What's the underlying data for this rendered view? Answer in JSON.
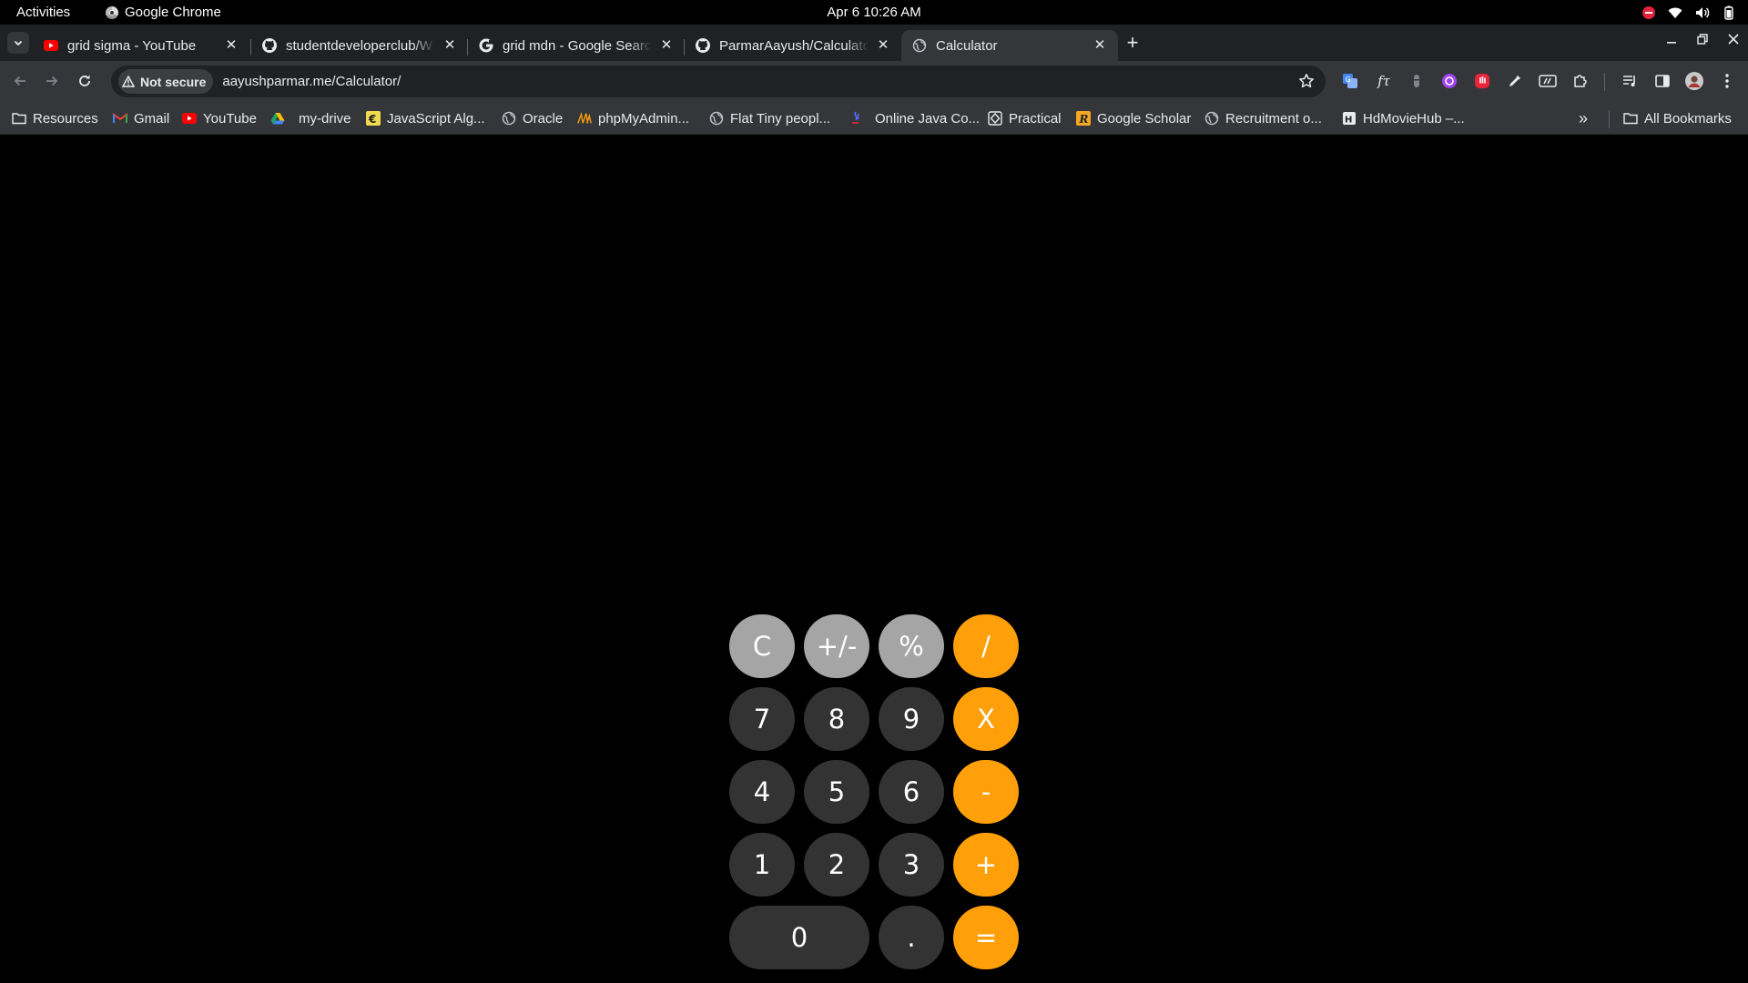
{
  "system_bar": {
    "activities": "Activities",
    "app_name": "Google Chrome",
    "clock": "Apr 6  10:26 AM"
  },
  "tabs": [
    {
      "title": "grid sigma - YouTube",
      "icon": "youtube-icon",
      "active": false
    },
    {
      "title": "studentdeveloperclub/W",
      "icon": "github-icon",
      "active": false
    },
    {
      "title": "grid mdn - Google Search",
      "icon": "google-icon",
      "active": false
    },
    {
      "title": "ParmarAayush/Calculato",
      "icon": "github-icon",
      "active": false
    },
    {
      "title": "Calculator",
      "icon": "globe-icon",
      "active": true
    }
  ],
  "toolbar": {
    "security_label": "Not secure",
    "url": "aayushparmar.me/Calculator/"
  },
  "bookmarks": [
    {
      "label": "Resources",
      "icon": "folder-icon"
    },
    {
      "label": "Gmail",
      "icon": "gmail-icon"
    },
    {
      "label": "YouTube",
      "icon": "youtube-icon"
    },
    {
      "label": "my-drive",
      "icon": "drive-icon"
    },
    {
      "label": "JavaScript Alg...",
      "icon": "js-icon"
    },
    {
      "label": "Oracle",
      "icon": "globe-icon"
    },
    {
      "label": "phpMyAdmin...",
      "icon": "phpmyadmin-icon"
    },
    {
      "label": "Flat Tiny peopl...",
      "icon": "globe-icon"
    },
    {
      "label": "Online Java Co...",
      "icon": "java-icon"
    },
    {
      "label": "Practical",
      "icon": "practical-icon"
    },
    {
      "label": "Google Scholar",
      "icon": "scholar-icon"
    },
    {
      "label": "Recruitment o...",
      "icon": "globe-icon"
    },
    {
      "label": "HdMovieHub –...",
      "icon": "movie-icon"
    }
  ],
  "all_bookmarks_label": "All Bookmarks",
  "calculator": {
    "display": "",
    "keys": {
      "clear": "C",
      "sign": "+/-",
      "percent": "%",
      "divide": "/",
      "seven": "7",
      "eight": "8",
      "nine": "9",
      "multiply": "X",
      "four": "4",
      "five": "5",
      "six": "6",
      "subtract": "-",
      "one": "1",
      "two": "2",
      "three": "3",
      "add": "+",
      "zero": "0",
      "decimal": ".",
      "equals": "="
    },
    "colors": {
      "digit": "#333333",
      "function": "#a5a5a5",
      "operator": "#ff9f0a"
    }
  }
}
